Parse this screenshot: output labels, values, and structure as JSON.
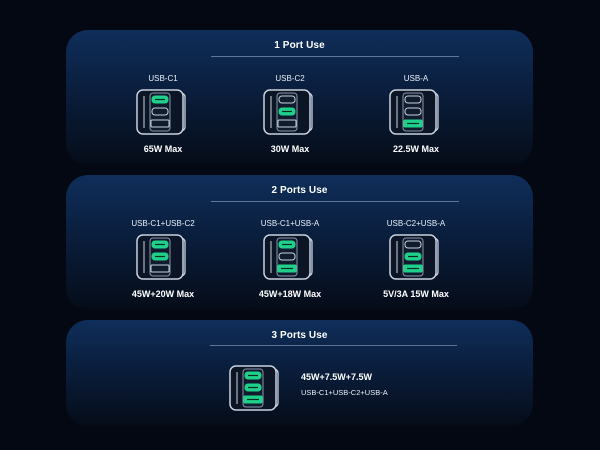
{
  "sections": [
    {
      "title": "1 Port Use",
      "items": [
        {
          "label": "USB-C1",
          "value": "65W Max",
          "active": [
            true,
            false,
            false
          ]
        },
        {
          "label": "USB-C2",
          "value": "30W Max",
          "active": [
            false,
            true,
            false
          ]
        },
        {
          "label": "USB-A",
          "value": "22.5W Max",
          "active": [
            false,
            false,
            true
          ]
        }
      ]
    },
    {
      "title": "2 Ports Use",
      "items": [
        {
          "label": "USB-C1+USB-C2",
          "value": "45W+20W Max",
          "active": [
            true,
            true,
            false
          ]
        },
        {
          "label": "USB-C1+USB-A",
          "value": "45W+18W Max",
          "active": [
            true,
            false,
            true
          ]
        },
        {
          "label": "USB-C2+USB-A",
          "value": "5V/3A 15W Max",
          "active": [
            false,
            true,
            true
          ]
        }
      ]
    },
    {
      "title": "3 Ports Use",
      "items": [
        {
          "label": "USB-C1+USB-C2+USB-A",
          "value": "45W+7.5W+7.5W",
          "active": [
            true,
            true,
            true
          ]
        }
      ]
    }
  ],
  "colors": {
    "active_port": "#1fd08a",
    "device_outline": "#c9d2df",
    "panel_top": "#0f2e5a",
    "panel_bottom": "#050c18"
  },
  "icon": "charger-port-diagram-icon"
}
